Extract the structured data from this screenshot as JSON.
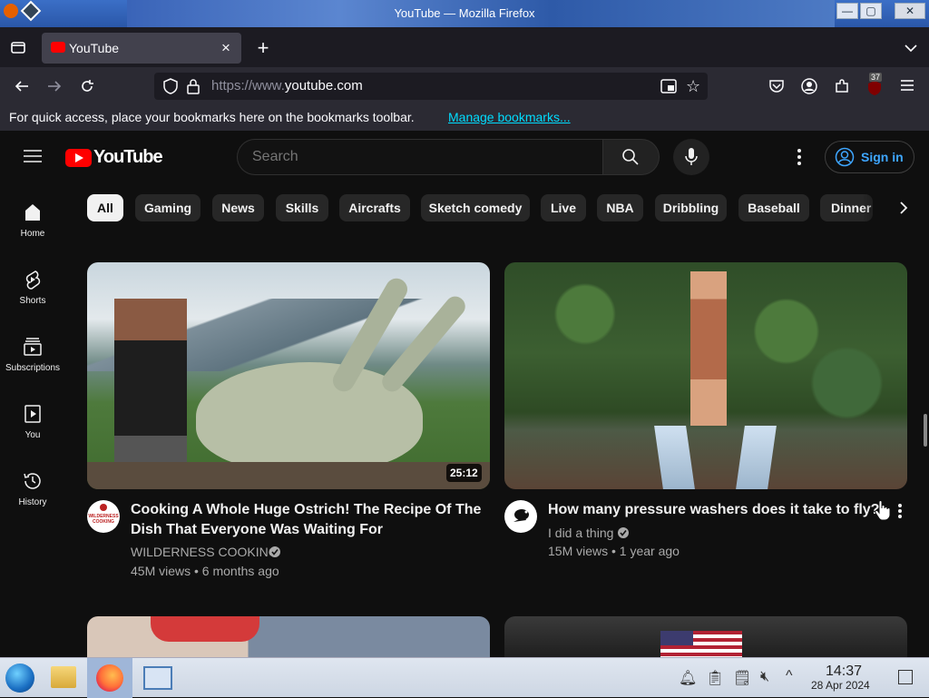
{
  "window": {
    "title": "YouTube — Mozilla Firefox",
    "btn_min": "—",
    "btn_max": "▢",
    "btn_close": "✕"
  },
  "browser": {
    "tab_title": "YouTube",
    "tab_close": "×",
    "new_tab": "+",
    "url_prefix": "https://www.",
    "url_host": "youtube.com",
    "bookmarks_text": "For quick access, place your bookmarks here on the bookmarks toolbar.",
    "bookmarks_link": "Manage bookmarks...",
    "ext_badge": "37"
  },
  "youtube": {
    "logo_text": "YouTube",
    "search_placeholder": "Search",
    "sign_in": "Sign in",
    "chips": [
      "All",
      "Gaming",
      "News",
      "Skills",
      "Aircrafts",
      "Sketch comedy",
      "Live",
      "NBA",
      "Dribbling",
      "Baseball",
      "Dinner"
    ],
    "sidebar": [
      {
        "label": "Home",
        "icon": "home-icon"
      },
      {
        "label": "Shorts",
        "icon": "shorts-icon"
      },
      {
        "label": "Subscriptions",
        "icon": "subscriptions-icon"
      },
      {
        "label": "You",
        "icon": "you-icon"
      },
      {
        "label": "History",
        "icon": "history-icon"
      }
    ],
    "videos": [
      {
        "title_line1": "Cooking A Whole Huge Ostrich! The Recipe Of The",
        "title_line2": "Dish That Everyone Was Waiting For",
        "channel": "WILDERNESS COOKING",
        "stats": "45M views • 6 months ago",
        "duration": "25:12",
        "avatar_text": "WILDERNESS COOKING"
      },
      {
        "title_line1": "How many pressure washers does it take to fly?",
        "channel": "I did a thing",
        "stats": "15M views • 1 year ago"
      }
    ]
  },
  "taskbar": {
    "time": "14:37",
    "date": "28 Apr 2024"
  }
}
